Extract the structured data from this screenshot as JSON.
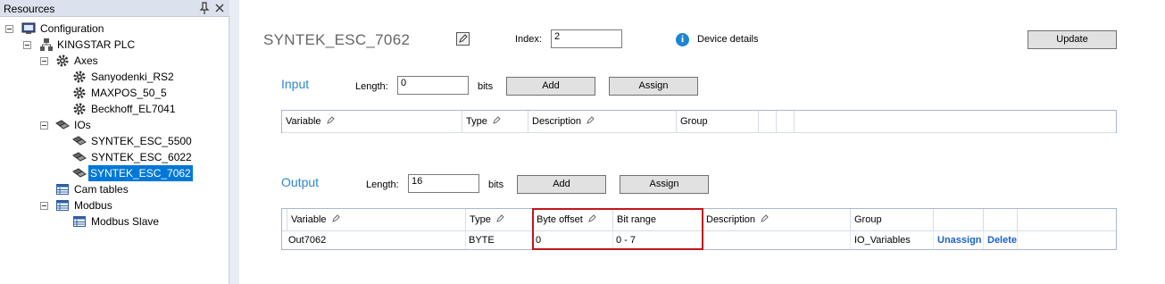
{
  "resources": {
    "title": "Resources",
    "pin_glyph": "⬇",
    "close_glyph": "✕",
    "tree": {
      "configuration": "Configuration",
      "plc": "KINGSTAR PLC",
      "axes": "Axes",
      "axes_items": [
        "Sanyodenki_RS2",
        "MAXPOS_50_5",
        "Beckhoff_EL7041"
      ],
      "ios": "IOs",
      "io_items": [
        "SYNTEK_ESC_5500",
        "SYNTEK_ESC_6022",
        "SYNTEK_ESC_7062"
      ],
      "cam_tables": "Cam tables",
      "modbus": "Modbus",
      "modbus_slave": "Modbus Slave"
    }
  },
  "device": {
    "name": "SYNTEK_ESC_7062",
    "index_label": "Index:",
    "index_value": "2",
    "details_label": "Device details",
    "update_label": "Update"
  },
  "input": {
    "title": "Input",
    "length_label": "Length:",
    "length_value": "0",
    "bits_label": "bits",
    "add_label": "Add",
    "assign_label": "Assign",
    "columns": [
      "Variable",
      "Type",
      "Description",
      "Group"
    ]
  },
  "output": {
    "title": "Output",
    "length_label": "Length:",
    "length_value": "16",
    "bits_label": "bits",
    "add_label": "Add",
    "assign_label": "Assign",
    "columns": [
      "Variable",
      "Type",
      "Byte offset",
      "Bit range",
      "Description",
      "Group"
    ],
    "rows": [
      {
        "variable": "Out7062",
        "type": "BYTE",
        "byte_offset": "0",
        "bit_range": "0 - 7",
        "description": "",
        "group": "IO_Variables",
        "unassign": "Unassign",
        "delete": "Delete"
      }
    ]
  },
  "colors": {
    "accent": "#2f86cb",
    "selection": "#0078d7",
    "highlight": "#c0161c",
    "link": "#1a62c6"
  }
}
